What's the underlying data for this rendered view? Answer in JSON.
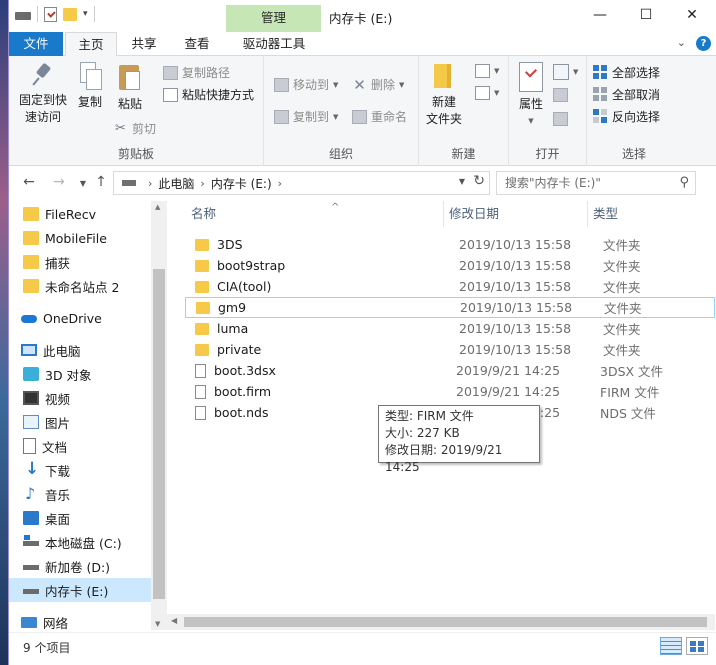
{
  "window": {
    "title": "内存卡 (E:)",
    "context_tab": "管理"
  },
  "ribbon_tabs": [
    "文件",
    "主页",
    "共享",
    "查看",
    "驱动器工具"
  ],
  "ribbon": {
    "clipboard": {
      "pin_label_1": "固定到快",
      "pin_label_2": "速访问",
      "copy": "复制",
      "paste": "粘贴",
      "copy_path": "复制路径",
      "paste_shortcut": "粘贴快捷方式",
      "cut": "剪切",
      "group": "剪贴板"
    },
    "organize": {
      "move_to": "移动到",
      "delete": "删除",
      "copy_to": "复制到",
      "rename": "重命名",
      "group": "组织"
    },
    "new": {
      "new_folder_1": "新建",
      "new_folder_2": "文件夹",
      "group": "新建"
    },
    "open": {
      "properties": "属性",
      "group": "打开"
    },
    "select": {
      "select_all": "全部选择",
      "select_none": "全部取消",
      "invert": "反向选择",
      "group": "选择"
    }
  },
  "address": {
    "crumbs": [
      "此电脑",
      "内存卡 (E:)"
    ],
    "search_placeholder": "搜索\"内存卡 (E:)\""
  },
  "nav": {
    "items": [
      {
        "label": "FileRecv",
        "icon": "folder-icon"
      },
      {
        "label": "MobileFile",
        "icon": "folder-icon"
      },
      {
        "label": "捕获",
        "icon": "folder-icon"
      },
      {
        "label": "未命名站点 2",
        "icon": "folder-icon"
      },
      {
        "label": "OneDrive",
        "icon": "onedrive-icon"
      },
      {
        "label": "此电脑",
        "icon": "computer-icon"
      },
      {
        "label": "3D 对象",
        "icon": "3d-objects-icon"
      },
      {
        "label": "视频",
        "icon": "video-icon"
      },
      {
        "label": "图片",
        "icon": "pictures-icon"
      },
      {
        "label": "文档",
        "icon": "documents-icon"
      },
      {
        "label": "下载",
        "icon": "download-icon"
      },
      {
        "label": "音乐",
        "icon": "music-icon"
      },
      {
        "label": "桌面",
        "icon": "desktop-icon"
      },
      {
        "label": "本地磁盘 (C:)",
        "icon": "system-drive-icon"
      },
      {
        "label": "新加卷 (D:)",
        "icon": "drive-icon"
      },
      {
        "label": "内存卡 (E:)",
        "icon": "drive-icon"
      },
      {
        "label": "网络",
        "icon": "network-icon"
      }
    ]
  },
  "columns": {
    "name": "名称",
    "date": "修改日期",
    "type": "类型"
  },
  "files": [
    {
      "name": "3DS",
      "date": "2019/10/13 15:58",
      "type": "文件夹",
      "kind": "folder"
    },
    {
      "name": "boot9strap",
      "date": "2019/10/13 15:58",
      "type": "文件夹",
      "kind": "folder"
    },
    {
      "name": "CIA(tool)",
      "date": "2019/10/13 15:58",
      "type": "文件夹",
      "kind": "folder"
    },
    {
      "name": "gm9",
      "date": "2019/10/13 15:58",
      "type": "文件夹",
      "kind": "folder"
    },
    {
      "name": "luma",
      "date": "2019/10/13 15:58",
      "type": "文件夹",
      "kind": "folder"
    },
    {
      "name": "private",
      "date": "2019/10/13 15:58",
      "type": "文件夹",
      "kind": "folder"
    },
    {
      "name": "boot.3dsx",
      "date": "2019/9/21 14:25",
      "type": "3DSX 文件",
      "kind": "file"
    },
    {
      "name": "boot.firm",
      "date": "2019/9/21 14:25",
      "type": "FIRM 文件",
      "kind": "file"
    },
    {
      "name": "boot.nds",
      "date": "2019/9/21 14:25",
      "type": "NDS 文件",
      "kind": "file"
    }
  ],
  "tooltip": {
    "type_line": "类型: FIRM 文件",
    "size_line": "大小: 227 KB",
    "date_line": "修改日期: 2019/9/21 14:25"
  },
  "status": {
    "count": "9 个项目"
  }
}
